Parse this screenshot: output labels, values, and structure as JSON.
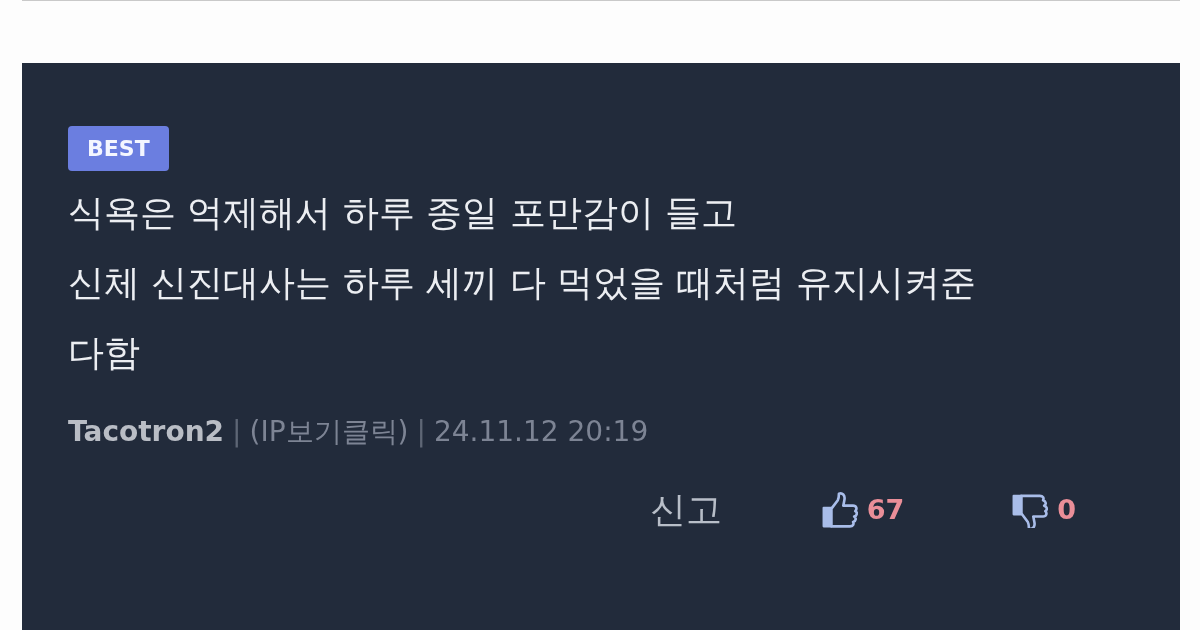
{
  "comment": {
    "badge": "BEST",
    "text": "식욕은 억제해서 하루 종일 포만감이 들고\n신체 신진대사는 하루 세끼 다 먹었을 때처럼 유지시켜준\n다함",
    "meta": [
      {
        "kind": "author",
        "text": "Tacotron2"
      },
      {
        "kind": "separator",
        "text": "|"
      },
      {
        "kind": "ip",
        "text": "(IP보기클릭)"
      },
      {
        "kind": "separator",
        "text": "|"
      },
      {
        "kind": "date",
        "text": "24.11.12 20:19"
      }
    ],
    "report": "신고",
    "votes": [
      {
        "kind": "up",
        "count": "67"
      },
      {
        "kind": "down",
        "count": "0"
      }
    ]
  }
}
